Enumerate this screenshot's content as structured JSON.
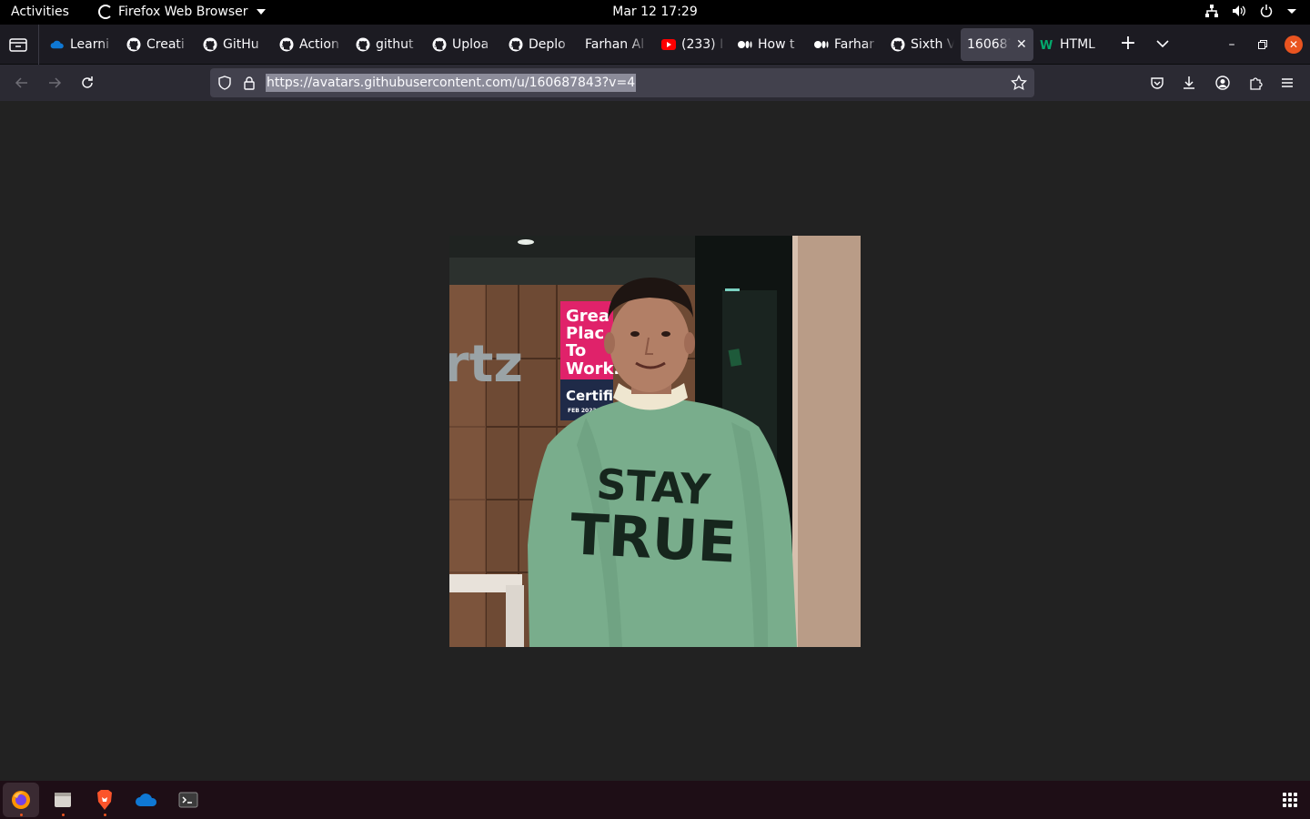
{
  "topbar": {
    "activities": "Activities",
    "app_menu": "Firefox Web Browser",
    "clock": "Mar 12  17:29",
    "tray_icons": [
      "network-icon",
      "volume-icon",
      "power-icon",
      "chevron-down-icon"
    ]
  },
  "browser": {
    "tabs": [
      {
        "label": "Learni",
        "icon": "onedrive-icon"
      },
      {
        "label": "Creati",
        "icon": "github-icon"
      },
      {
        "label": "GitHu",
        "icon": "github-icon"
      },
      {
        "label": "Action",
        "icon": "github-icon"
      },
      {
        "label": "githut",
        "icon": "github-icon"
      },
      {
        "label": "Uploa",
        "icon": "github-icon"
      },
      {
        "label": "Deplo",
        "icon": "github-icon"
      },
      {
        "label": "Farhan Al",
        "icon": ""
      },
      {
        "label": "(233) I",
        "icon": "youtube-icon"
      },
      {
        "label": "How t",
        "icon": "medium-icon"
      },
      {
        "label": "Farhar",
        "icon": "medium-icon"
      },
      {
        "label": "Sixth V",
        "icon": "github-icon"
      },
      {
        "label": "160687",
        "icon": "",
        "active": true
      },
      {
        "label": "HTML",
        "icon": "w3-icon"
      }
    ],
    "url": "https://avatars.githubusercontent.com/u/160687843?v=4"
  },
  "content": {
    "image_alt": "avatar photo of a person in green sweatshirt",
    "shirt_text_line1": "STAY",
    "shirt_text_line2": "TRUE",
    "poster_lines": [
      "Grea",
      "Plac",
      "To",
      "Work.",
      "Certifi",
      "FEB 2023"
    ],
    "wall_sign": "rtz"
  },
  "dock": {
    "apps": [
      "firefox-icon",
      "files-icon",
      "brave-icon",
      "onedrive-icon",
      "terminal-icon"
    ]
  },
  "colors": {
    "accent": "#e95420",
    "urlbar": "#42414d",
    "navbar": "#2b2a33",
    "content_bg": "#222222"
  }
}
